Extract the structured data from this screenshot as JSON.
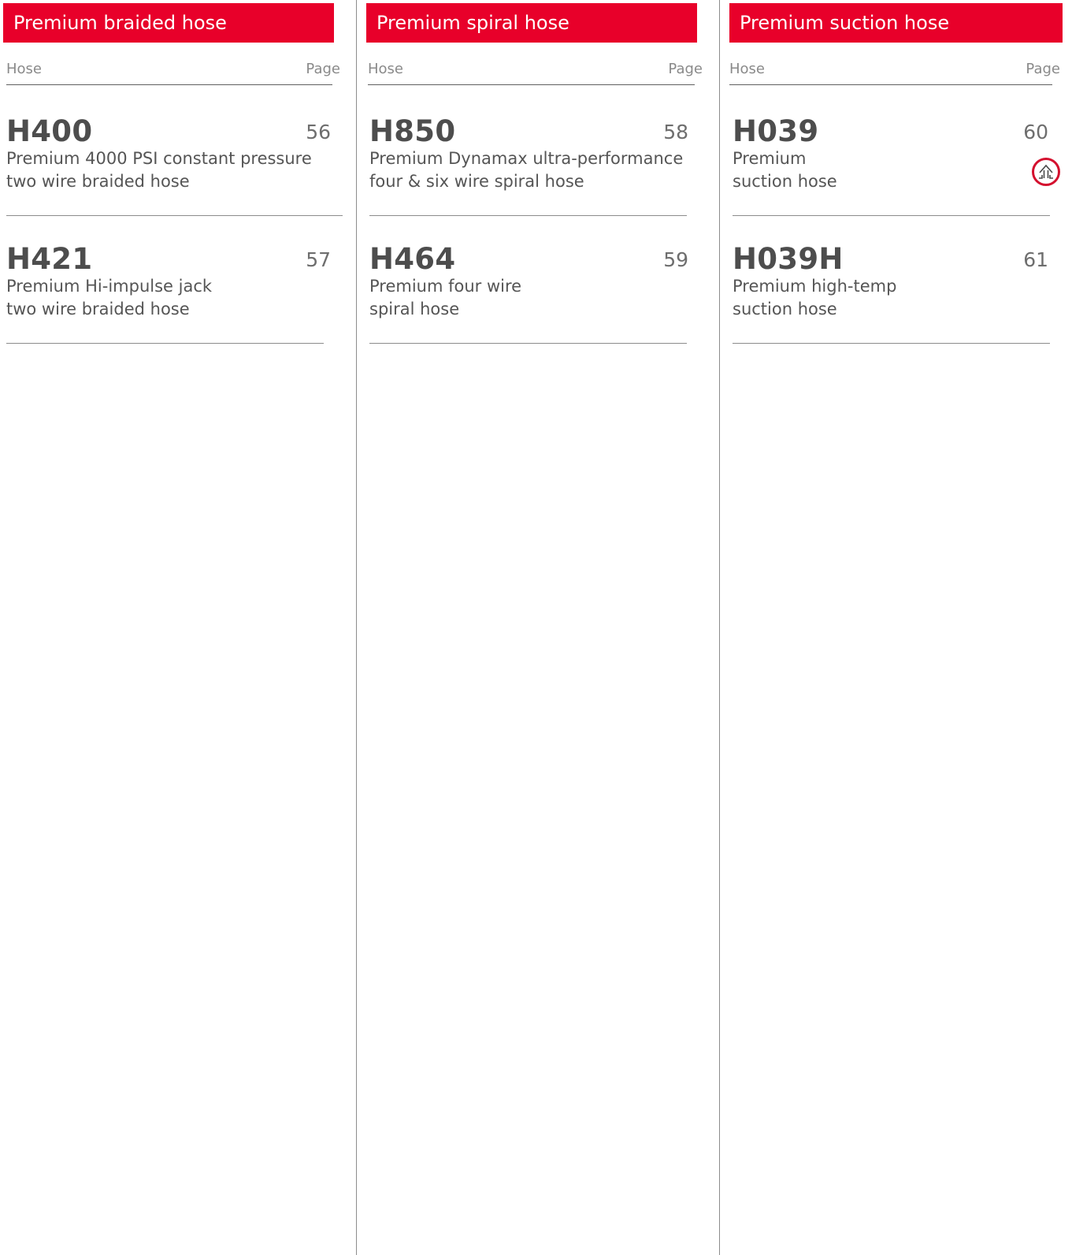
{
  "columns": [
    {
      "title": "Premium braided hose",
      "header": {
        "hose": "Hose",
        "page": "Page"
      },
      "items": [
        {
          "code": "H400",
          "page": "56",
          "line1": "Premium 4000 PSI constant pressure",
          "line2": "two wire braided hose"
        },
        {
          "code": "H421",
          "page": "57",
          "line1": "Premium Hi-impulse jack",
          "line2": "two wire braided hose"
        }
      ]
    },
    {
      "title": "Premium spiral hose",
      "header": {
        "hose": "Hose",
        "page": "Page"
      },
      "items": [
        {
          "code": "H850",
          "page": "58",
          "line1": "Premium Dynamax ultra-performance",
          "line2": "four & six wire spiral hose"
        },
        {
          "code": "H464",
          "page": "59",
          "line1": "Premium four wire",
          "line2": "spiral hose"
        }
      ]
    },
    {
      "title": "Premium suction hose",
      "header": {
        "hose": "Hose",
        "page": "Page"
      },
      "items": [
        {
          "code": "H039",
          "page": "60",
          "line1": "Premium",
          "line2": "suction hose",
          "icon": "suction-arrow-badge-icon"
        },
        {
          "code": "H039H",
          "page": "61",
          "line1": "Premium high-temp",
          "line2": "suction hose"
        }
      ]
    }
  ],
  "colors": {
    "banner": "#e8002a",
    "badge": "#d4102e",
    "text": "#505050"
  }
}
